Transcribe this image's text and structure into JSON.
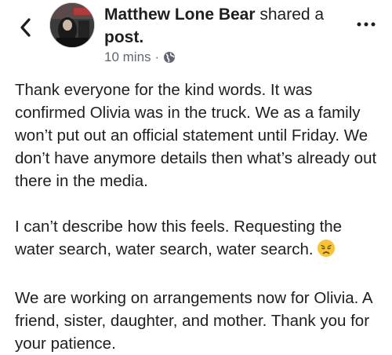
{
  "header": {
    "author_name": "Matthew Lone Bear",
    "action_text": " shared a ",
    "post_word": "post.",
    "timestamp": "10 mins",
    "separator": "·",
    "back_icon": "chevron-left-icon",
    "privacy_icon": "globe-icon",
    "more_icon": "more-dots-icon"
  },
  "post": {
    "paragraphs": [
      "Thank everyone for the kind words. It was confirmed Olivia was in the truck. We as a family won’t put out an official statement until Friday. We don’t have anymore details then what’s already out there in the media.",
      "I can’t describe how this feels. Requesting the water search, water search, water search.",
      "We are working on arrangements now for Olivia. A friend, sister, daughter, and mother. Thank you for your patience."
    ],
    "emoji": "disappointed-face-emoji"
  },
  "colors": {
    "text": "#1c1e21",
    "secondary": "#606770",
    "emoji_face": "#f7c437"
  }
}
